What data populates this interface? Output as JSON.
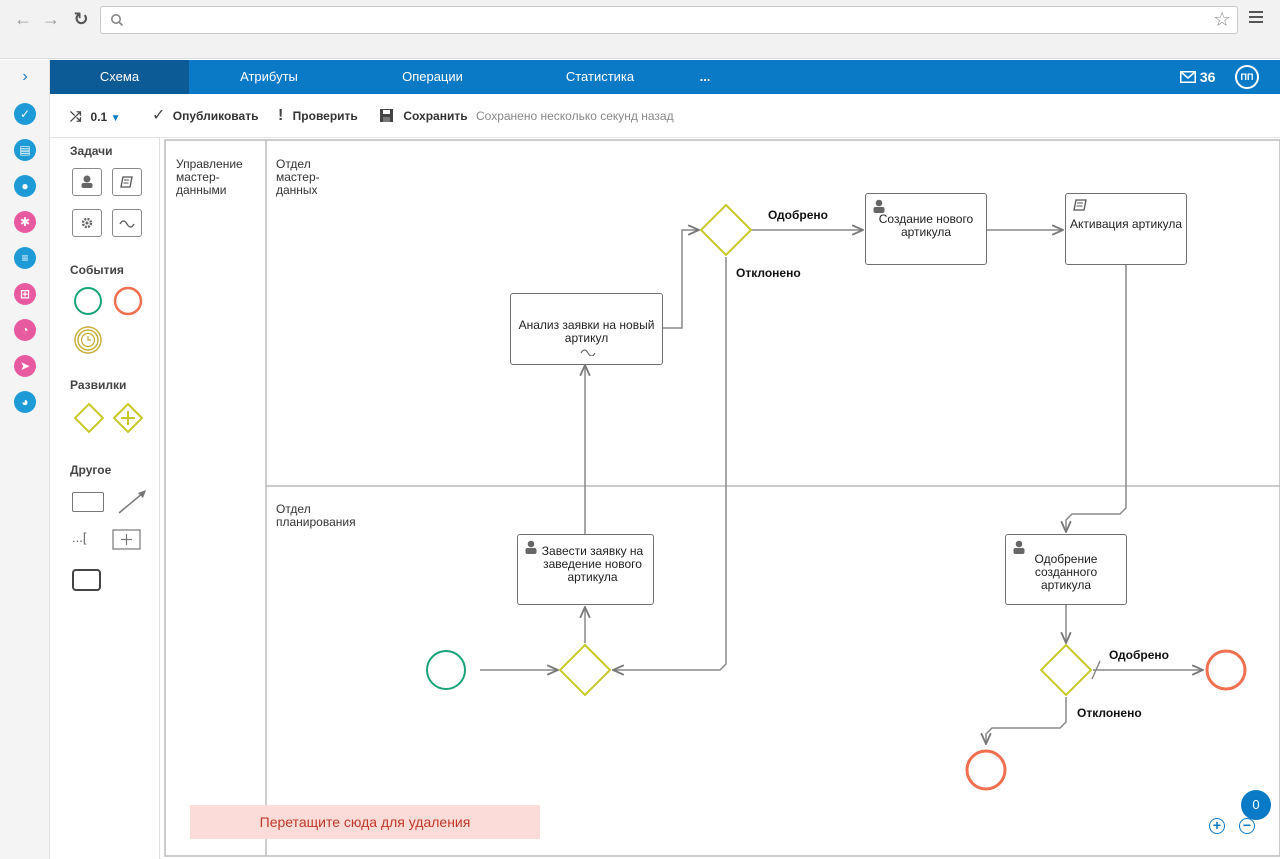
{
  "browser": {
    "back": "←",
    "forward": "→",
    "reload": "↻",
    "address_value": "",
    "star": "☆"
  },
  "rail": {
    "expand": "›",
    "items": [
      {
        "name": "tasks-icon",
        "color": "#1e9bd7"
      },
      {
        "name": "briefcase-icon",
        "color": "#1e9bd7"
      },
      {
        "name": "user-icon",
        "color": "#1e9bd7"
      },
      {
        "name": "settings-icon",
        "color": "#e85aa0"
      },
      {
        "name": "document-icon",
        "color": "#1e9bd7"
      },
      {
        "name": "org-icon",
        "color": "#e85aa0"
      },
      {
        "name": "report-icon",
        "color": "#e85aa0"
      },
      {
        "name": "tag-icon",
        "color": "#e85aa0"
      },
      {
        "name": "pie-chart-icon",
        "color": "#1e9bd7"
      }
    ]
  },
  "appbar": {
    "tabs": [
      "Схема",
      "Атрибуты",
      "Операции",
      "Статистика",
      "..."
    ],
    "mail_count": "36",
    "avatar": "ПП"
  },
  "toolbar": {
    "version": "0.1",
    "publish": "Опубликовать",
    "check": "Проверить",
    "save": "Сохранить",
    "status": "Сохранено несколько секунд назад"
  },
  "palette": {
    "tasks": "Задачи",
    "events": "События",
    "gateways": "Развилки",
    "other": "Другое",
    "annotation": "...["
  },
  "diagram": {
    "pool": "Управление мастер-данными",
    "lane_top": "Отдел мастер-данных",
    "lane_bottom": "Отдел планирования",
    "tasks": {
      "analysis": "Анализ заявки на новый артикул",
      "create": "Создание нового артикула",
      "activate": "Активация артикула",
      "request": "Завести заявку на заведение нового артикула",
      "approve": "Одобрение созданного артикула"
    },
    "flows": {
      "approved_1": "Одобрено",
      "rejected_1": "Отклонено",
      "approved_2": "Одобрено",
      "rejected_2": "Отклонено"
    }
  },
  "trash_zone": "Перетащите сюда для удаления",
  "notifications_count": "0",
  "zoom_in": "+",
  "zoom_out": "−",
  "colors": {
    "brand": "#0b7ac6",
    "gateway": "#c8c82a",
    "start_event": "#1aa37a",
    "end_event": "#f07050"
  }
}
